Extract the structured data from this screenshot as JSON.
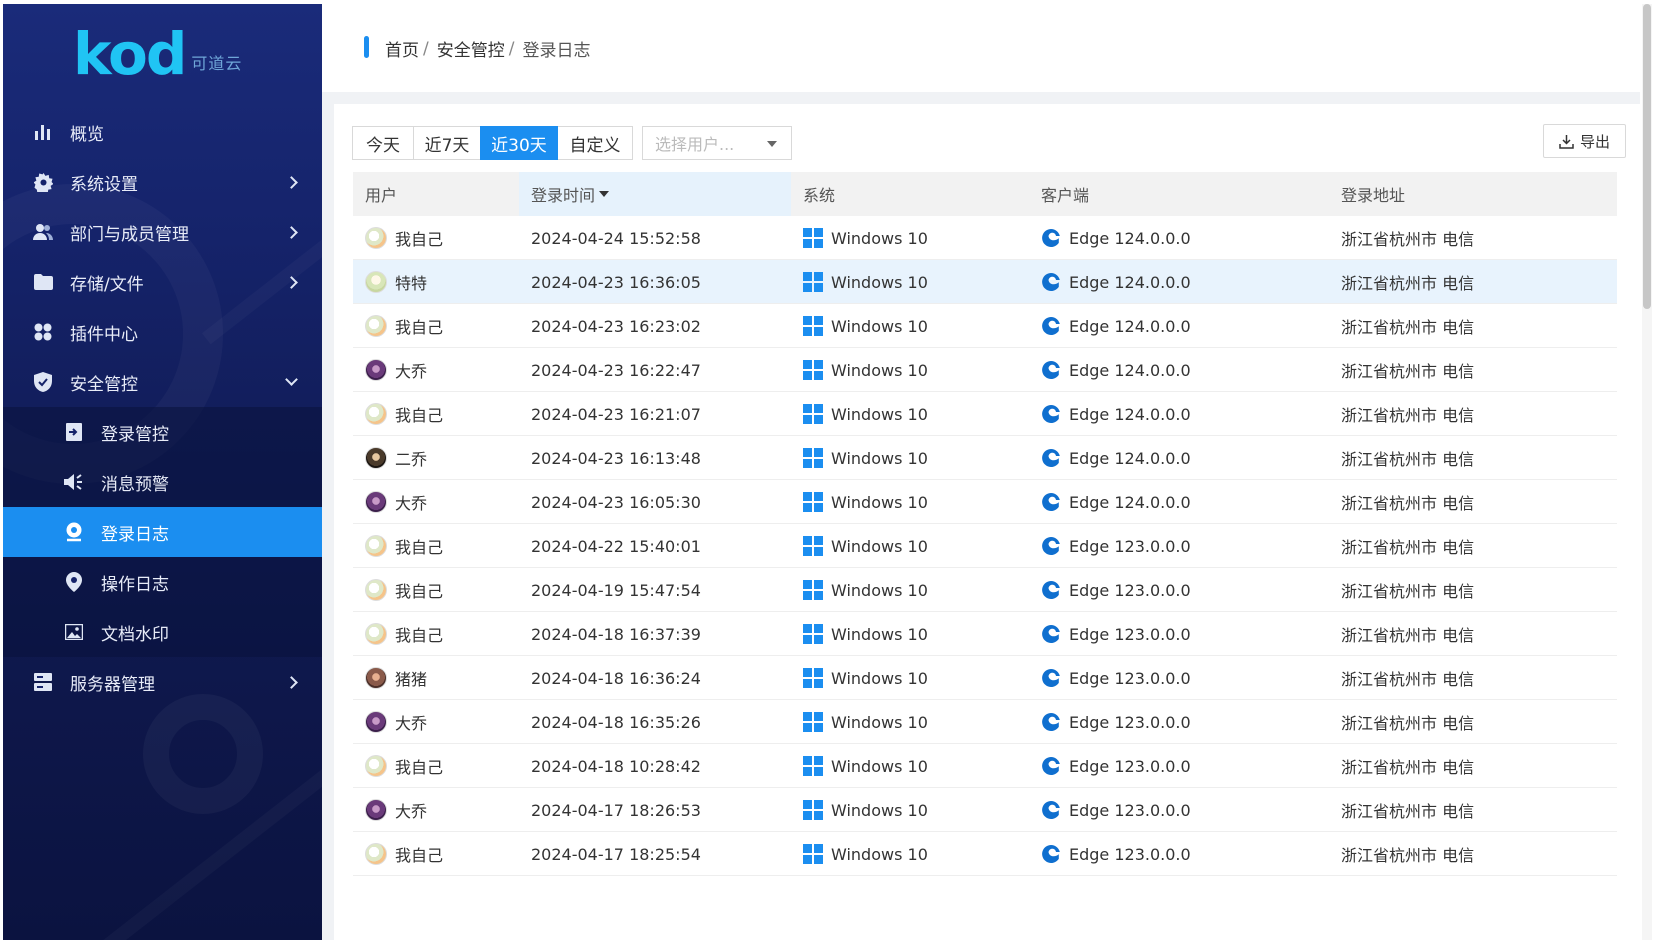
{
  "app": {
    "logo_text": "kod",
    "logo_sub": "可道云"
  },
  "sidebar": {
    "items": [
      {
        "label": "概览",
        "icon": "bar-chart-icon"
      },
      {
        "label": "系统设置",
        "icon": "gear-icon"
      },
      {
        "label": "部门与成员管理",
        "icon": "users-icon"
      },
      {
        "label": "存储/文件",
        "icon": "folder-icon"
      },
      {
        "label": "插件中心",
        "icon": "plugins-icon"
      },
      {
        "label": "安全管控",
        "icon": "shield-icon"
      },
      {
        "label": "服务器管理",
        "icon": "server-icon"
      }
    ],
    "security_sub": [
      {
        "label": "登录管控",
        "icon": "login-icon"
      },
      {
        "label": "消息预警",
        "icon": "speaker-icon"
      },
      {
        "label": "登录日志",
        "icon": "location-icon"
      },
      {
        "label": "操作日志",
        "icon": "pin-icon"
      },
      {
        "label": "文档水印",
        "icon": "image-icon"
      }
    ]
  },
  "breadcrumb": {
    "home": "首页",
    "section": "安全管控",
    "current": "登录日志",
    "sep": "/"
  },
  "filters": {
    "ranges": [
      "今天",
      "近7天",
      "近30天",
      "自定义"
    ],
    "active_range": "近30天",
    "user_select_placeholder": "选择用户..."
  },
  "toolbar": {
    "export_label": "导出"
  },
  "table": {
    "columns": [
      "用户",
      "登录时间",
      "系统",
      "客户端",
      "登录地址"
    ],
    "sorted_column": "登录时间",
    "rows": [
      {
        "user": "我自己",
        "avatar": "me",
        "time": "2024-04-24 15:52:58",
        "os": "Windows 10",
        "client": "Edge 124.0.0.0",
        "address": "浙江省杭州市 电信"
      },
      {
        "user": "特特",
        "avatar": "tt",
        "time": "2024-04-23 16:36:05",
        "os": "Windows 10",
        "client": "Edge 124.0.0.0",
        "address": "浙江省杭州市 电信"
      },
      {
        "user": "我自己",
        "avatar": "me",
        "time": "2024-04-23 16:23:02",
        "os": "Windows 10",
        "client": "Edge 124.0.0.0",
        "address": "浙江省杭州市 电信"
      },
      {
        "user": "大乔",
        "avatar": "dq",
        "time": "2024-04-23 16:22:47",
        "os": "Windows 10",
        "client": "Edge 124.0.0.0",
        "address": "浙江省杭州市 电信"
      },
      {
        "user": "我自己",
        "avatar": "me",
        "time": "2024-04-23 16:21:07",
        "os": "Windows 10",
        "client": "Edge 124.0.0.0",
        "address": "浙江省杭州市 电信"
      },
      {
        "user": "二乔",
        "avatar": "eq",
        "time": "2024-04-23 16:13:48",
        "os": "Windows 10",
        "client": "Edge 124.0.0.0",
        "address": "浙江省杭州市 电信"
      },
      {
        "user": "大乔",
        "avatar": "dq",
        "time": "2024-04-23 16:05:30",
        "os": "Windows 10",
        "client": "Edge 124.0.0.0",
        "address": "浙江省杭州市 电信"
      },
      {
        "user": "我自己",
        "avatar": "me",
        "time": "2024-04-22 15:40:01",
        "os": "Windows 10",
        "client": "Edge 123.0.0.0",
        "address": "浙江省杭州市 电信"
      },
      {
        "user": "我自己",
        "avatar": "me",
        "time": "2024-04-19 15:47:54",
        "os": "Windows 10",
        "client": "Edge 123.0.0.0",
        "address": "浙江省杭州市 电信"
      },
      {
        "user": "我自己",
        "avatar": "me",
        "time": "2024-04-18 16:37:39",
        "os": "Windows 10",
        "client": "Edge 123.0.0.0",
        "address": "浙江省杭州市 电信"
      },
      {
        "user": "猪猪",
        "avatar": "zz",
        "time": "2024-04-18 16:36:24",
        "os": "Windows 10",
        "client": "Edge 123.0.0.0",
        "address": "浙江省杭州市 电信"
      },
      {
        "user": "大乔",
        "avatar": "dq",
        "time": "2024-04-18 16:35:26",
        "os": "Windows 10",
        "client": "Edge 123.0.0.0",
        "address": "浙江省杭州市 电信"
      },
      {
        "user": "我自己",
        "avatar": "me",
        "time": "2024-04-18 10:28:42",
        "os": "Windows 10",
        "client": "Edge 123.0.0.0",
        "address": "浙江省杭州市 电信"
      },
      {
        "user": "大乔",
        "avatar": "dq",
        "time": "2024-04-17 18:26:53",
        "os": "Windows 10",
        "client": "Edge 123.0.0.0",
        "address": "浙江省杭州市 电信"
      },
      {
        "user": "我自己",
        "avatar": "me",
        "time": "2024-04-17 18:25:54",
        "os": "Windows 10",
        "client": "Edge 123.0.0.0",
        "address": "浙江省杭州市 电信"
      }
    ],
    "highlighted_row_index": 1
  },
  "colors": {
    "accent": "#1b8ef0",
    "sidebar_bg": "#15236a"
  }
}
